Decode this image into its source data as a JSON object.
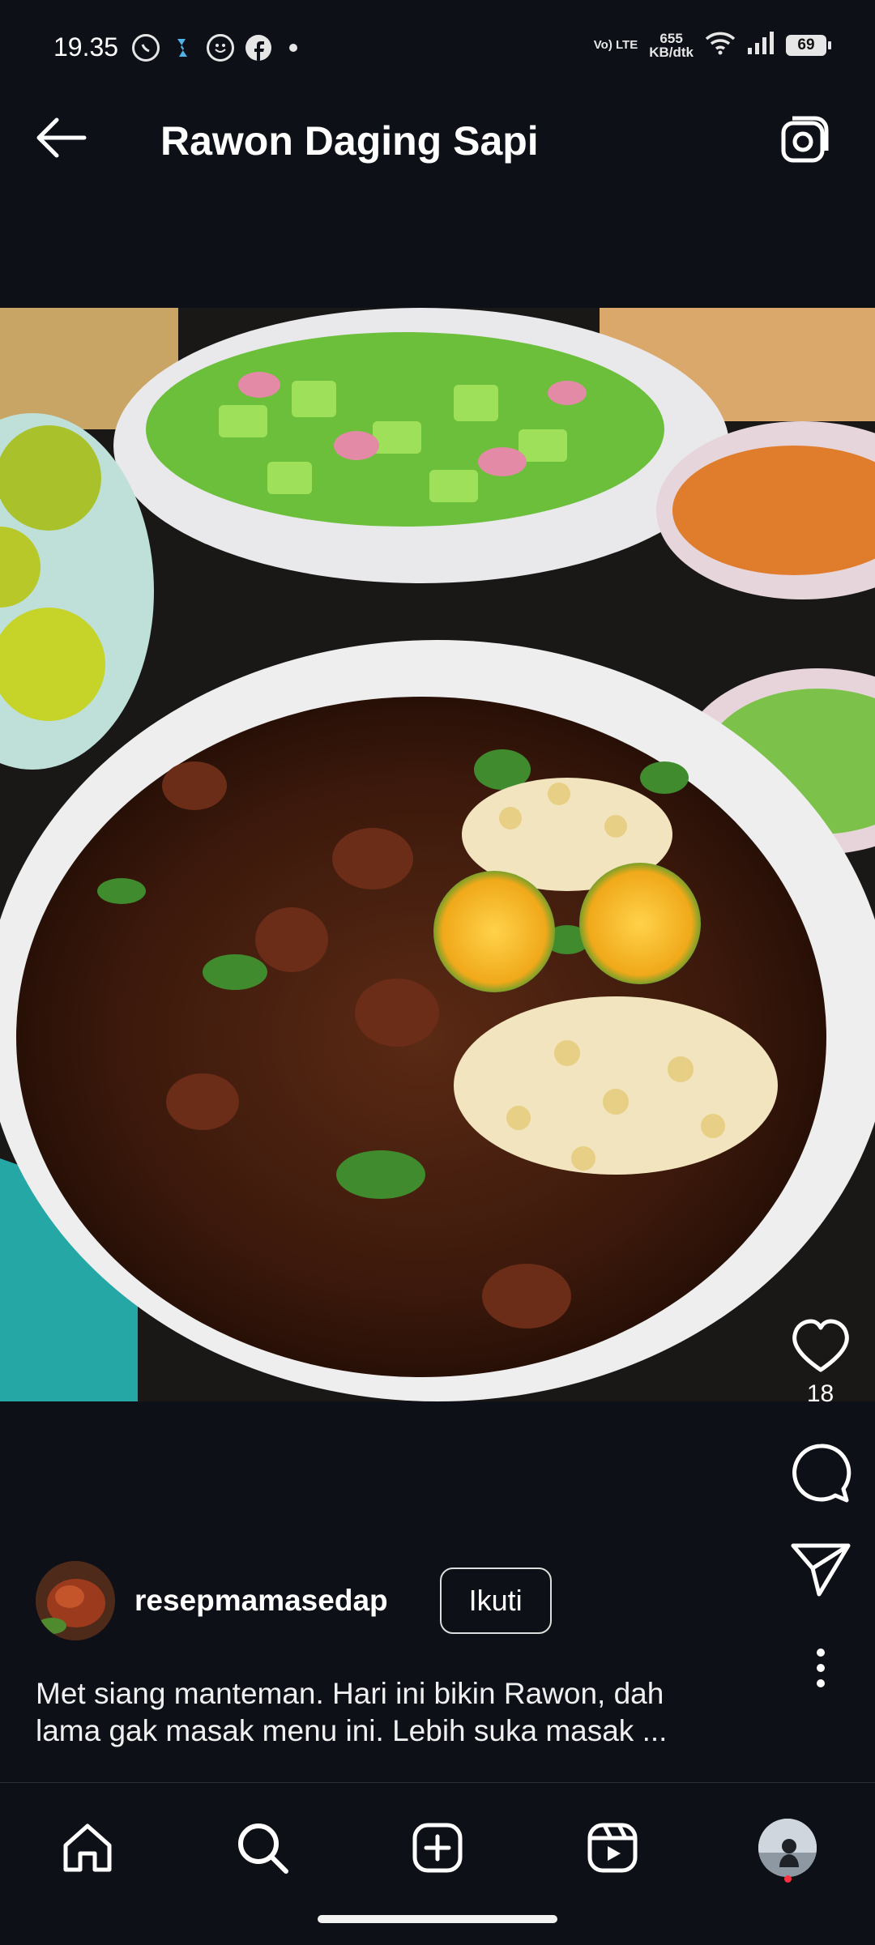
{
  "status_bar": {
    "time": "19.35",
    "volte": "Vo) LTE",
    "network_speed_value": "655",
    "network_speed_unit": "KB/dtk",
    "battery": "69",
    "icons": [
      "whatsapp-icon",
      "app-icon",
      "smiley-icon",
      "facebook-icon",
      "wifi-icon",
      "signal-icon"
    ]
  },
  "header": {
    "title": "Rawon Daging Sapi",
    "back_icon": "arrow-left-icon",
    "camera_icon": "camera-icon"
  },
  "post": {
    "image_alt": "Bowl of Rawon beef soup with bean sprouts and lime",
    "likes": "18",
    "author": "resepmamasedap",
    "follow_label": "Ikuti",
    "caption_line1": "Met siang manteman. Hari ini bikin Rawon, dah",
    "caption_line2": "lama gak masak menu ini. Lebih suka masak ..."
  },
  "bottom_nav": {
    "items": [
      "home-icon",
      "search-icon",
      "create-icon",
      "reels-icon",
      "profile-avatar"
    ]
  },
  "colors": {
    "background": "#0d1117",
    "text": "#ffffff",
    "notification": "#ff3040"
  }
}
